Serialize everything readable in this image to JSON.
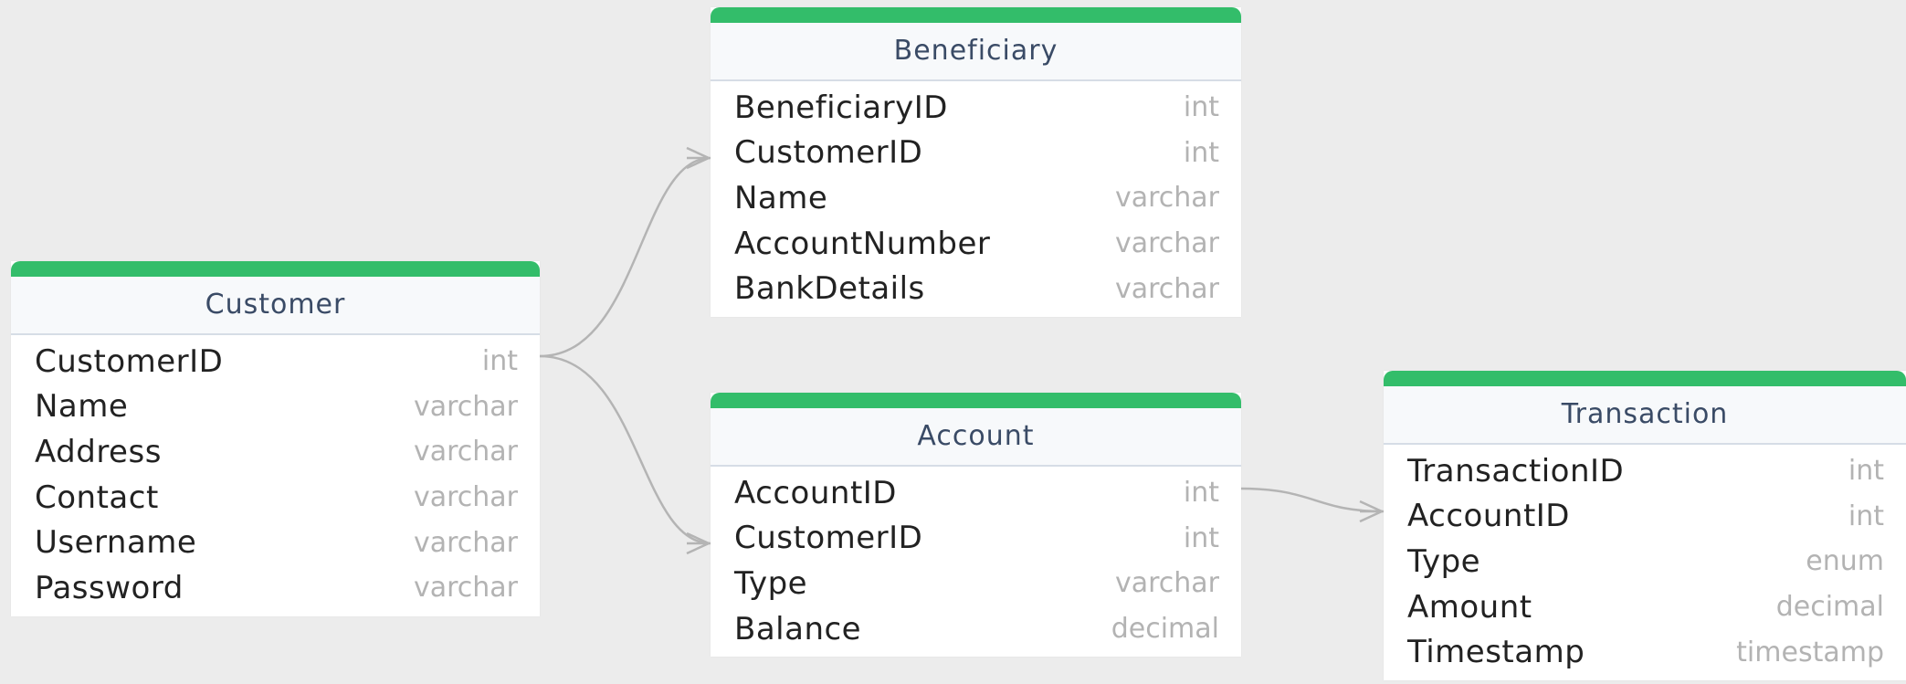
{
  "theme": {
    "canvas_background": "#ececec",
    "table_accent": "#33bd6a",
    "header_background": "#f7f9fb",
    "header_text": "#3a4b66",
    "field_text": "#222222",
    "type_text": "#b3b3b3",
    "connector_color": "#b4b4b4"
  },
  "tables": {
    "customer": {
      "title": "Customer",
      "fields": [
        {
          "name": "CustomerID",
          "type": "int"
        },
        {
          "name": "Name",
          "type": "varchar"
        },
        {
          "name": "Address",
          "type": "varchar"
        },
        {
          "name": "Contact",
          "type": "varchar"
        },
        {
          "name": "Username",
          "type": "varchar"
        },
        {
          "name": "Password",
          "type": "varchar"
        }
      ]
    },
    "beneficiary": {
      "title": "Beneficiary",
      "fields": [
        {
          "name": "BeneficiaryID",
          "type": "int"
        },
        {
          "name": "CustomerID",
          "type": "int"
        },
        {
          "name": "Name",
          "type": "varchar"
        },
        {
          "name": "AccountNumber",
          "type": "varchar"
        },
        {
          "name": "BankDetails",
          "type": "varchar"
        }
      ]
    },
    "account": {
      "title": "Account",
      "fields": [
        {
          "name": "AccountID",
          "type": "int"
        },
        {
          "name": "CustomerID",
          "type": "int"
        },
        {
          "name": "Type",
          "type": "varchar"
        },
        {
          "name": "Balance",
          "type": "decimal"
        }
      ]
    },
    "transaction": {
      "title": "Transaction",
      "fields": [
        {
          "name": "TransactionID",
          "type": "int"
        },
        {
          "name": "AccountID",
          "type": "int"
        },
        {
          "name": "Type",
          "type": "enum"
        },
        {
          "name": "Amount",
          "type": "decimal"
        },
        {
          "name": "Timestamp",
          "type": "timestamp"
        }
      ]
    }
  },
  "relationships": [
    {
      "from_table": "Customer",
      "from_field": "CustomerID",
      "to_table": "Beneficiary",
      "to_field": "CustomerID",
      "cardinality": "one-to-many"
    },
    {
      "from_table": "Customer",
      "from_field": "CustomerID",
      "to_table": "Account",
      "to_field": "CustomerID",
      "cardinality": "one-to-many"
    },
    {
      "from_table": "Account",
      "from_field": "AccountID",
      "to_table": "Transaction",
      "to_field": "AccountID",
      "cardinality": "one-to-many"
    }
  ]
}
